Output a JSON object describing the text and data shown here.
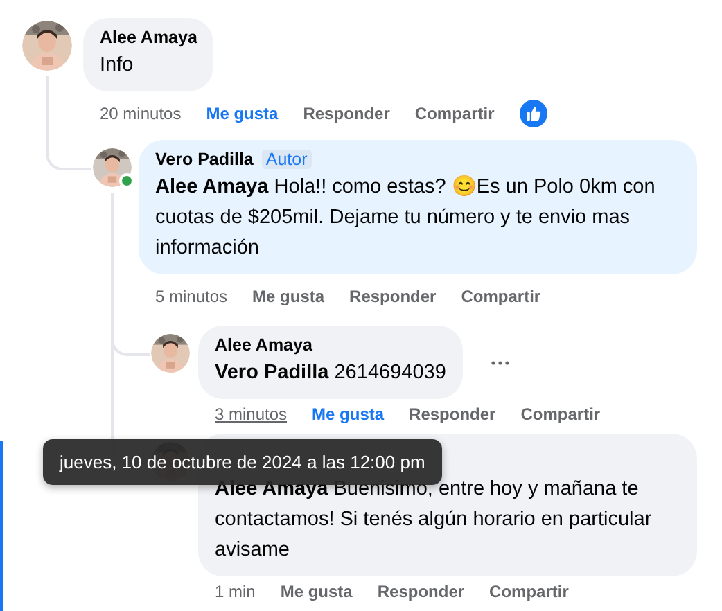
{
  "comments": [
    {
      "author": "Alee Amaya",
      "text": "Info",
      "time": "20 minutos",
      "time_hovered": false,
      "liked": true,
      "like_reaction": true,
      "online": false,
      "menu_visible": false,
      "actions": [
        "Me gusta",
        "Responder",
        "Compartir"
      ],
      "children": [
        {
          "author": "Vero Padilla",
          "badge": "Autor",
          "text": "**Alee Amaya** Hola!! como estas? 😊Es un Polo 0km con cuotas de $205mil. Dejame tu número y te envio mas información",
          "time": "5 minutos",
          "time_hovered": false,
          "liked": false,
          "like_reaction": false,
          "online": true,
          "menu_visible": false,
          "actions": [
            "Me gusta",
            "Responder",
            "Compartir"
          ],
          "children": [
            {
              "author": "Alee Amaya",
              "text": "**Vero Padilla** 2614694039",
              "time": "3 minutos",
              "time_hovered": true,
              "liked": true,
              "like_reaction": false,
              "online": false,
              "menu_visible": true,
              "actions": [
                "Me gusta",
                "Responder",
                "Compartir"
              ]
            },
            {
              "text": "**Alee Amaya** Buenisimo, entre hoy y mañana te contactamos! Si tenés algún horario en particular avisame",
              "time": "1 min",
              "time_hovered": false,
              "liked": false,
              "like_reaction": false,
              "online": false,
              "menu_visible": false,
              "actions": [
                "Me gusta",
                "Responder",
                "Compartir"
              ]
            }
          ]
        }
      ]
    }
  ],
  "tooltip": {
    "text": "jueves, 10 de octubre de 2024 a las 12:00 pm"
  }
}
